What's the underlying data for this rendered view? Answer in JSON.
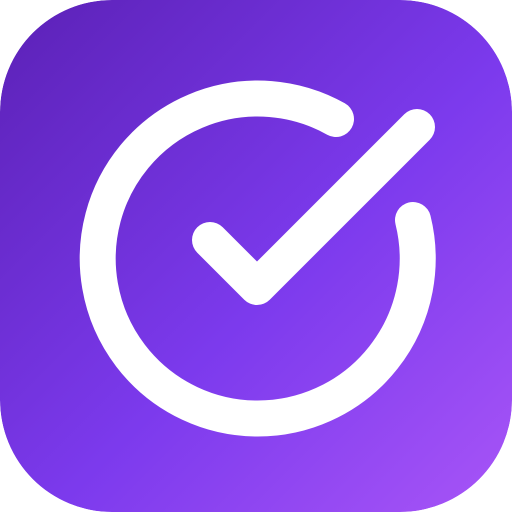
{
  "app_icon": {
    "icon": "check-circle-icon",
    "colors": {
      "gradient_start": "#5B21B6",
      "gradient_mid": "#7C3AED",
      "gradient_end": "#A855F7",
      "glyph": "#FFFFFF"
    }
  }
}
